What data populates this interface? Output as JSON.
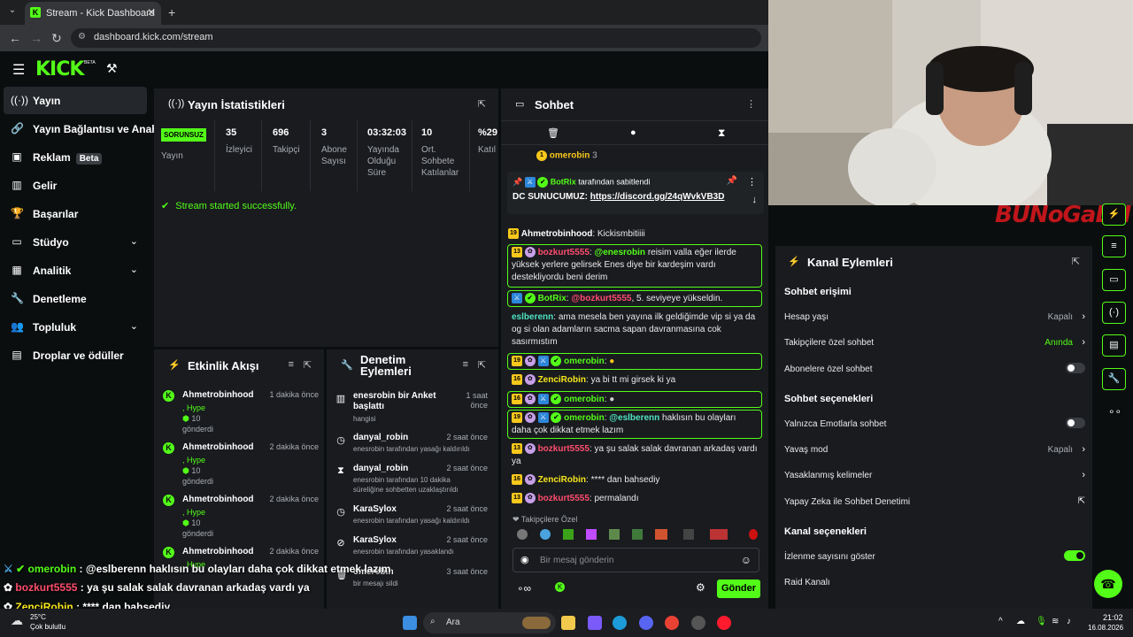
{
  "browser": {
    "tab_title": "Stream - Kick Dashboard",
    "url": "dashboard.kick.com/stream"
  },
  "header": {
    "logo": "KICK",
    "beta": "BETA"
  },
  "sidebar": {
    "items": [
      {
        "label": "Yayın",
        "icon": "broadcast-icon"
      },
      {
        "label": "Yayın Bağlantısı ve Anahtarı",
        "icon": "link-icon"
      },
      {
        "label": "Reklam",
        "icon": "ad-icon",
        "badge": "Beta"
      },
      {
        "label": "Gelir",
        "icon": "revenue-icon"
      },
      {
        "label": "Başarılar",
        "icon": "trophy-icon"
      },
      {
        "label": "Stüdyo",
        "icon": "studio-icon"
      },
      {
        "label": "Analitik",
        "icon": "analytics-icon"
      },
      {
        "label": "Denetleme",
        "icon": "wrench-icon"
      },
      {
        "label": "Topluluk",
        "icon": "community-icon"
      },
      {
        "label": "Droplar ve ödüller",
        "icon": "drops-icon"
      }
    ]
  },
  "stats": {
    "title": "Yayın İstatistikleri",
    "status": "SORUNSUZ",
    "status_label": "Yayın",
    "cols": [
      {
        "value": "35",
        "label": "İzleyici"
      },
      {
        "value": "696",
        "label": "Takipçi"
      },
      {
        "value": "3",
        "label": "Abone Sayısı"
      },
      {
        "value": "03:32:03",
        "label": "Yayında Olduğu Süre"
      },
      {
        "value": "10",
        "label": "Ort. Sohbete Katılanlar"
      },
      {
        "value": "%29",
        "label": "Katıl"
      }
    ],
    "message": "Stream started successfully."
  },
  "events": {
    "title": "Etkinlik Akışı",
    "items": [
      {
        "name": "Ahmetrobinhood",
        "time": "1 dakika önce",
        "type": ", Hype",
        "amount": "10",
        "verb": "gönderdi"
      },
      {
        "name": "Ahmetrobinhood",
        "time": "2 dakika önce",
        "type": ", Hype",
        "amount": "10",
        "verb": "gönderdi"
      },
      {
        "name": "Ahmetrobinhood",
        "time": "2 dakika önce",
        "type": ", Hype",
        "amount": "10",
        "verb": "gönderdi"
      },
      {
        "name": "Ahmetrobinhood",
        "time": "2 dakika önce",
        "type": ", Hype",
        "amount": "",
        "verb": ""
      }
    ]
  },
  "moderation": {
    "title": "Denetim Eylemleri",
    "items": [
      {
        "name": "enesrobin bir Anket başlattı",
        "time": "1 saat önce",
        "sub": "hangisi"
      },
      {
        "name": "danyal_robin",
        "time": "2 saat önce",
        "sub": "enesrobin tarafından yasağı kaldırıldı"
      },
      {
        "name": "danyal_robin",
        "time": "2 saat önce",
        "sub": "enesrobin tarafından 10 dakika süreliğine sohbetten uzaklaştırıldı"
      },
      {
        "name": "KaraSylox",
        "time": "2 saat önce",
        "sub": "enesrobin tarafından yasağı kaldırıldı"
      },
      {
        "name": "KaraSylox",
        "time": "2 saat önce",
        "sub": "enesrobin tarafından yasaklandı"
      },
      {
        "name": "omerobin",
        "time": "3 saat önce",
        "sub": "bir mesajı sildi"
      }
    ]
  },
  "chat": {
    "title": "Sohbet",
    "top_user": "omerobin",
    "top_count": "3",
    "pinned_by": "BotRix",
    "pinned_label": "tarafından sabitlendi",
    "pinned_prefix": "DC SUNUCUMUZ:",
    "pinned_link": "https://discord.gg/24qWvkVB3D",
    "messages": [
      {
        "badge": "19",
        "user": "Ahmetrobinhood",
        "text": "Kickismbitiiii"
      },
      {
        "badge": "13",
        "user": "bozkurt5555",
        "mention": "@enesrobin",
        "text": "reisim valla eğer ilerde yüksek yerlere gelirsek Enes diye bir kardeşim vardı destekliyordu beni derim"
      },
      {
        "user": "BotRix",
        "mention": "@bozkurt5555",
        "text": ", 5. seviyeye yükseldin."
      },
      {
        "user": "eslberenn",
        "text": "ama mesela ben yayına ilk geldiğimde vip si ya da og si olan adamların sacma sapan davranmasına cok sasırmıstım"
      },
      {
        "badge": "19",
        "user": "omerobin",
        "text": ""
      },
      {
        "badge": "16",
        "user": "ZenciRobin",
        "text": "ya bi tt mi girsek ki ya"
      },
      {
        "badge": "16",
        "user": "omerobin",
        "text": ""
      },
      {
        "badge": "19",
        "user": "omerobin",
        "mention": "@eslberenn",
        "text": "haklısın bu olayları daha çok dikkat etmek lazım"
      },
      {
        "badge": "13",
        "user": "bozkurt5555",
        "text": "ya şu salak salak davranan arkadaş vardı ya"
      },
      {
        "badge": "16",
        "user": "ZenciRobin",
        "text": "**** dan bahsediy"
      },
      {
        "badge": "13",
        "user": "bozkurt5555",
        "text": "permalandı"
      }
    ],
    "followers_only": "Takipçilere Özel",
    "input_placeholder": "Bir mesaj gönderin",
    "send": "Gönder"
  },
  "actions": {
    "title": "Kanal Eylemleri",
    "sections": {
      "access": "Sohbet erişimi",
      "options": "Sohbet seçenekleri",
      "channel": "Kanal seçenekleri"
    },
    "rows": {
      "age": {
        "label": "Hesap yaşı",
        "value": "Kapalı"
      },
      "followers": {
        "label": "Takipçilere özel sohbet",
        "value": "Anında"
      },
      "subs": {
        "label": "Abonelere özel sohbet"
      },
      "emotes": {
        "label": "Yalnızca Emotlarla sohbet"
      },
      "slow": {
        "label": "Yavaş mod",
        "value": "Kapalı"
      },
      "banned": {
        "label": "Yasaklanmış kelimeler"
      },
      "ai": {
        "label": "Yapay Zeka ile Sohbet Denetimi"
      },
      "viewers": {
        "label": "İzlenme sayısını göster"
      },
      "raid": {
        "label": "Raid Kanalı"
      }
    }
  },
  "overlay": {
    "lines": [
      {
        "user": "omerobin",
        "text": ": @eslberenn haklısın bu olayları daha çok dikkat etmek lazım"
      },
      {
        "user": "bozkurt5555",
        "text": ": ya şu salak salak davranan arkadaş vardı ya"
      },
      {
        "user": "ZenciRobin",
        "text": ": **** dan bahsediy"
      }
    ],
    "watermark": "BUNoGaLLI"
  },
  "taskbar": {
    "weather_temp": "25°C",
    "weather_desc": "Çok bulutlu",
    "search": "Ara",
    "time": "21:02",
    "date": "16.08.2026"
  }
}
